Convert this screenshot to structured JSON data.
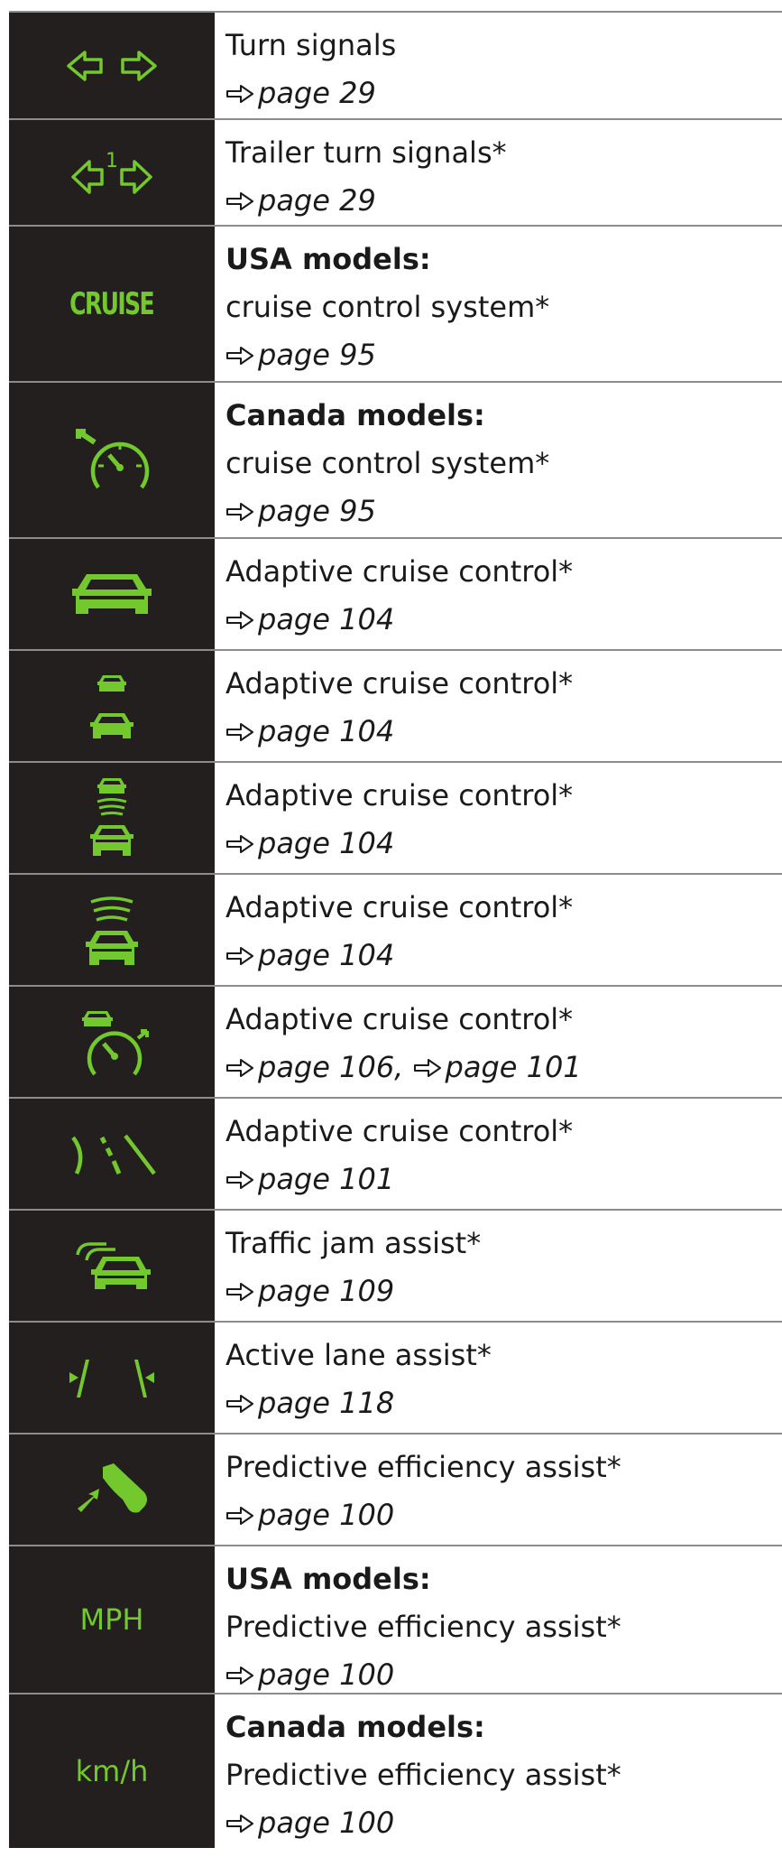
{
  "colors": {
    "icon_green": "#72c82d",
    "icon_bg": "#231f1e",
    "rule": "#8c8c8c"
  },
  "rows": [
    {
      "icon": "turn-signals-icon",
      "title": "Turn signals",
      "refs": [
        {
          "text": "page 29"
        }
      ]
    },
    {
      "icon": "trailer-turn-signals-icon",
      "icon_label": "1",
      "title": "Trailer turn signals*",
      "refs": [
        {
          "text": "page 29"
        }
      ]
    },
    {
      "icon": "cruise-text-icon",
      "icon_label": "CRUISE",
      "heading": "USA models:",
      "title": "cruise control system*",
      "refs": [
        {
          "text": "page 95"
        }
      ]
    },
    {
      "icon": "speedometer-icon",
      "heading": "Canada models:",
      "title": "cruise control system*",
      "refs": [
        {
          "text": "page 95"
        }
      ]
    },
    {
      "icon": "vehicle-icon",
      "title": "Adaptive cruise control*",
      "refs": [
        {
          "text": "page 104"
        }
      ]
    },
    {
      "icon": "vehicle-distance-icon",
      "title": "Adaptive cruise control*",
      "refs": [
        {
          "text": "page 104"
        }
      ]
    },
    {
      "icon": "vehicle-radar-distance-icon",
      "title": "Adaptive cruise control*",
      "refs": [
        {
          "text": "page 104"
        }
      ]
    },
    {
      "icon": "vehicle-radar-icon",
      "title": "Adaptive cruise control*",
      "refs": [
        {
          "text": "page 104"
        }
      ]
    },
    {
      "icon": "vehicle-speedometer-icon",
      "title": "Adaptive cruise control*",
      "refs": [
        {
          "text": "page 106"
        },
        {
          "text": "page 101"
        }
      ],
      "ref_separator": ", "
    },
    {
      "icon": "curve-road-icon",
      "title": "Adaptive cruise control*",
      "refs": [
        {
          "text": "page 101"
        }
      ]
    },
    {
      "icon": "traffic-jam-icon",
      "title": "Traffic jam assist*",
      "refs": [
        {
          "text": "page 109"
        }
      ]
    },
    {
      "icon": "lane-assist-icon",
      "title": "Active lane assist*",
      "refs": [
        {
          "text": "page 118"
        }
      ]
    },
    {
      "icon": "efficiency-foot-icon",
      "title": "Predictive efficiency assist*",
      "refs": [
        {
          "text": "page 100"
        }
      ]
    },
    {
      "icon": "mph-text-icon",
      "icon_label": "MPH",
      "heading": "USA models:",
      "title": "Predictive efficiency assist*",
      "refs": [
        {
          "text": "page 100"
        }
      ]
    },
    {
      "icon": "kmh-text-icon",
      "icon_label": "km/h",
      "heading": "Canada models:",
      "title": "Predictive efficiency assist*",
      "refs": [
        {
          "text": "page 100"
        }
      ]
    }
  ]
}
